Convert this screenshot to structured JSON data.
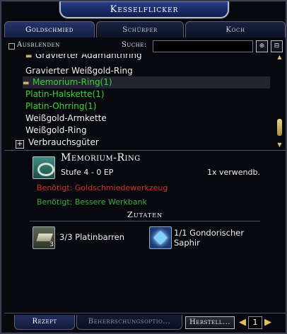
{
  "window": {
    "title": "Kesselflicker"
  },
  "tabs": [
    {
      "label": "Goldschmied",
      "active": true
    },
    {
      "label": "Schürfer",
      "active": false
    },
    {
      "label": "Koch",
      "active": false
    }
  ],
  "filter": {
    "hide_label": "Ausblenden",
    "hide_checked": false,
    "search_label": "Suche:",
    "search_value": "",
    "btn1_glyph": "⊕",
    "btn2_glyph": "⊟"
  },
  "recipe_list": {
    "rows": [
      {
        "label": "Gravierter Adamanthring",
        "color": "white",
        "partial": true
      },
      {
        "label": "Gravierter Weißgold-Ring",
        "color": "white"
      },
      {
        "label": "Memorium-Ring(1)",
        "color": "green",
        "selected": true,
        "has_tool_icon": true
      },
      {
        "label": "Platin-Halskette(1)",
        "color": "green"
      },
      {
        "label": "Platin-Ohrring(1)",
        "color": "green"
      },
      {
        "label": "Weißgold-Armkette",
        "color": "white"
      },
      {
        "label": "Weißgold-Ring",
        "color": "white"
      },
      {
        "label": "Verbrauchsgüter",
        "color": "white",
        "category": true
      }
    ]
  },
  "detail": {
    "name": "Memorium-Ring",
    "level": "Stufe 4 - 0 EP",
    "uses": "1x verwendb.",
    "requirement_missing": "Benötigt: Goldschmiedewerkzeug",
    "requirement_met": "Benötigt: Bessere Werkbank",
    "ingredients_header": "Zutaten",
    "ingredients": [
      {
        "label": "3/3 Platinbarren",
        "badge": "3",
        "icon": "platinum-bar-icon"
      },
      {
        "label": "1/1 Gondorischer Saphir",
        "badge": "",
        "icon": "sapphire-icon"
      }
    ]
  },
  "bottom": {
    "tab_recipe": "Rezept",
    "tab_mastery": "Beherrschungsoptio...",
    "make_button": "Herstell...",
    "quantity": "1"
  },
  "colors": {
    "green_text": "#3ed33a",
    "red_text": "#d8332a",
    "title_blue": "#182a66"
  }
}
